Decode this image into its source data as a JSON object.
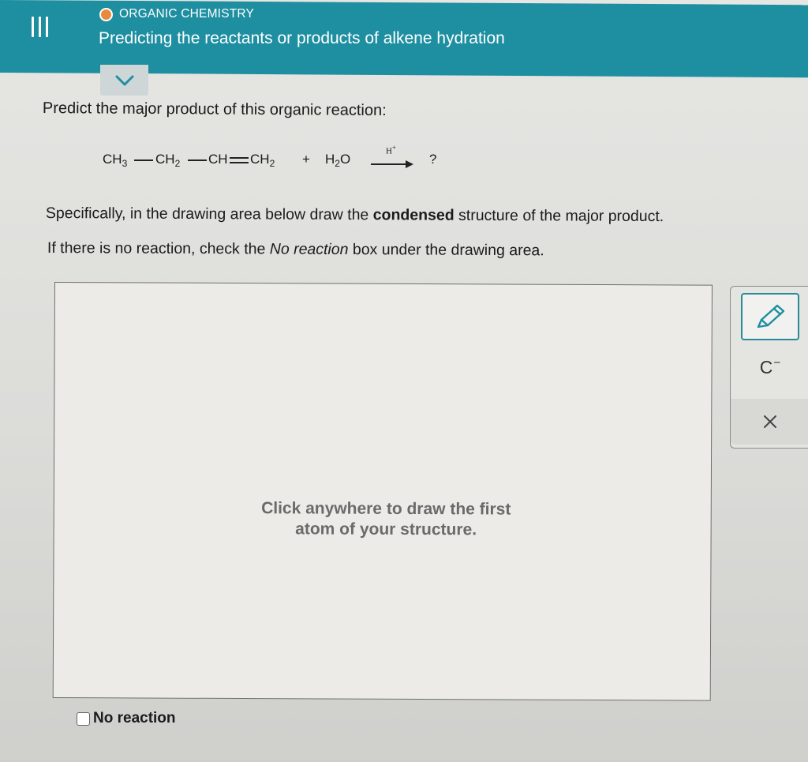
{
  "header": {
    "category": "ORGANIC CHEMISTRY",
    "topic_title": "Predicting the reactants or products of alkene hydration",
    "accent_color": "#1e8fa1",
    "status_dot_color": "#e9893a",
    "menu_icon": "hamburger-icon",
    "expand_icon": "chevron-down-icon"
  },
  "question": {
    "prompt": "Predict the major product of this organic reaction:",
    "reaction": {
      "r1": "CH",
      "r1_sub": "3",
      "r2": "CH",
      "r2_sub": "2",
      "r3": "CH",
      "r4": "CH",
      "r4_sub": "2",
      "plus": "+",
      "water": "H",
      "water_sub": "2",
      "water_end": "O",
      "catalyst": "H",
      "catalyst_sup": "+",
      "product": "?"
    },
    "instr1_pre": "Specifically, in the drawing area below draw the ",
    "instr1_bold": "condensed",
    "instr1_post": " structure of the major product.",
    "instr2_pre": "If there is no reaction, check the ",
    "instr2_em": "No reaction",
    "instr2_post": " box under the drawing area."
  },
  "drawing_area": {
    "placeholder_line1": "Click anywhere to draw the first",
    "placeholder_line2": "atom of your structure."
  },
  "no_reaction": {
    "label": "No reaction",
    "checked": false
  },
  "toolbar": {
    "tools": [
      "pencil-icon",
      "charge-icon",
      "close-icon"
    ],
    "charge_label": "C",
    "charge_sup": "−",
    "active_tool": "pencil-icon"
  }
}
